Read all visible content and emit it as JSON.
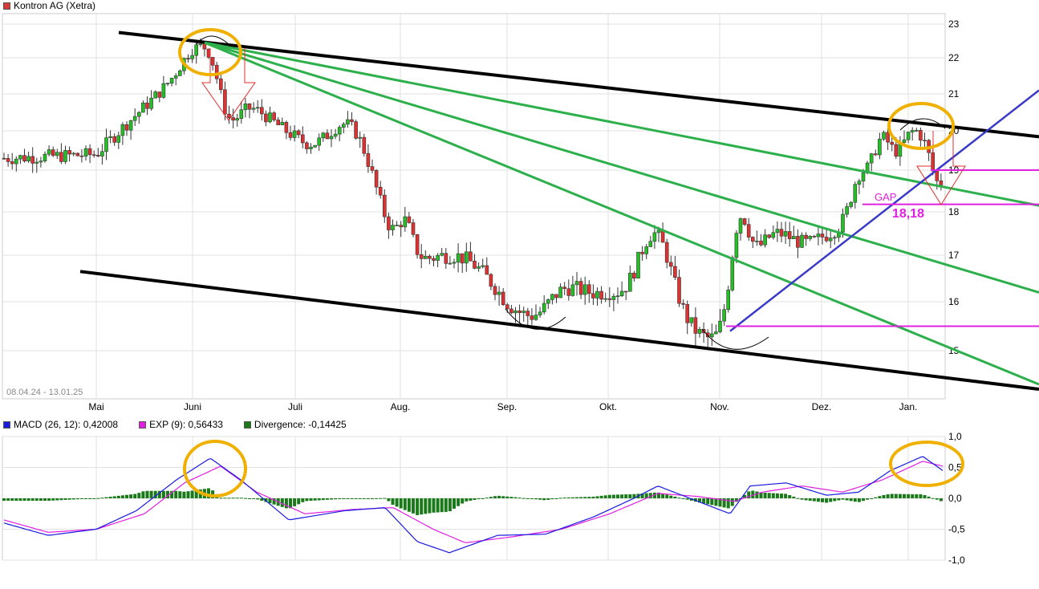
{
  "header": {
    "title": "Kontron AG (Xetra)",
    "swatch_color": "#d93a3a"
  },
  "date_range_label": "08.04.24 - 13.01.25",
  "colors": {
    "up": "#22c022",
    "down": "#e03030",
    "trend_black": "#000000",
    "trend_green": "#2db04b",
    "trend_blue": "#3a3ac8",
    "annotation_magenta": "#e020e0",
    "highlight": "#f0b000",
    "macd": "#1a1ae0",
    "exp": "#e020e0",
    "divergence": "#1a7a1a"
  },
  "annotations": {
    "gap_label": "GAP",
    "gap_value": "18,18"
  },
  "chart_data": [
    {
      "type": "candlestick",
      "title": "Kontron AG (Xetra)",
      "x_tick_labels": [
        "Mai",
        "Juni",
        "Juli",
        "Aug.",
        "Sep.",
        "Okt.",
        "Nov.",
        "Dez.",
        "Jan."
      ],
      "y_tick_labels": [
        "15",
        "16",
        "17",
        "18",
        "19",
        "20",
        "21",
        "22",
        "23"
      ],
      "ylim": [
        14.0,
        23.3
      ],
      "grid": true,
      "approx_close": [
        {
          "period": "Apr",
          "value": 19.3
        },
        {
          "period": "Mai",
          "value": 19.4
        },
        {
          "period": "Juni",
          "value": 21.9
        },
        {
          "period": "Juli",
          "value": 19.8
        },
        {
          "period": "Aug.",
          "value": 16.9
        },
        {
          "period": "Sep.",
          "value": 15.9
        },
        {
          "period": "Okt.",
          "value": 16.2
        },
        {
          "period": "Nov.",
          "value": 15.1
        },
        {
          "period": "Dez.",
          "value": 17.4
        },
        {
          "period": "Jan.",
          "value": 18.6
        }
      ],
      "horizontal_levels": [
        19.0,
        18.18,
        15.5
      ]
    },
    {
      "type": "line",
      "title": "MACD",
      "y_tick_labels": [
        "1,0",
        "0,5",
        "0,0",
        "-0,5",
        "-1,0"
      ],
      "ylim": [
        -1.0,
        1.0
      ],
      "series": [
        {
          "name": "MACD (26, 12): 0,42008"
        },
        {
          "name": "EXP (9): 0,56433"
        },
        {
          "name": "Divergence: -0,14425"
        }
      ]
    }
  ],
  "legend": {
    "macd": "MACD (26, 12): 0,42008",
    "exp": "EXP (9): 0,56433",
    "divergence": "Divergence: -0,14425"
  }
}
